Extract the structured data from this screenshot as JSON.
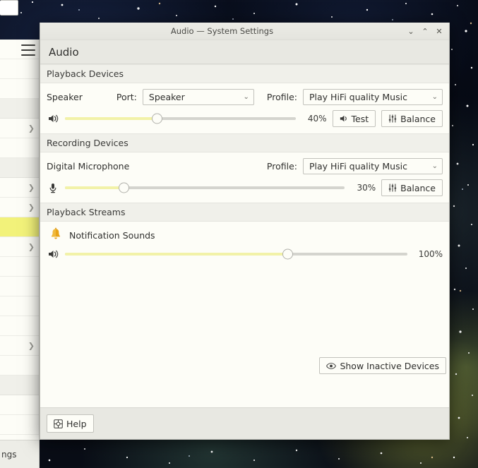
{
  "window": {
    "title": "Audio — System Settings",
    "controls": [
      {
        "name": "minimize",
        "glyph": "⌄"
      },
      {
        "name": "maximize",
        "glyph": "⌃"
      },
      {
        "name": "close",
        "glyph": "✕"
      }
    ]
  },
  "header": {
    "menu_icon": "hamburger-icon",
    "page_title": "Audio"
  },
  "sections": {
    "playback_devices": {
      "title": "Playback Devices",
      "device_name": "Speaker",
      "port_label": "Port:",
      "port_value": "Speaker",
      "profile_label": "Profile:",
      "profile_value": "Play HiFi quality Music",
      "volume_percent": "40%",
      "volume_value": 40,
      "test_label": "Test",
      "balance_label": "Balance"
    },
    "recording_devices": {
      "title": "Recording Devices",
      "device_name": "Digital Microphone",
      "profile_label": "Profile:",
      "profile_value": "Play HiFi quality Music",
      "volume_percent": "30%",
      "volume_value": 21,
      "balance_label": "Balance"
    },
    "playback_streams": {
      "title": "Playback Streams",
      "stream_name": "Notification Sounds",
      "volume_percent": "100%",
      "volume_value": 65
    }
  },
  "footer": {
    "show_inactive_label": "Show Inactive Devices",
    "help_label": "Help"
  },
  "background_list": {
    "bottom_label": "ngs",
    "rows": [
      {
        "type": "item",
        "chevron": false
      },
      {
        "type": "item",
        "chevron": false
      },
      {
        "type": "item",
        "chevron": false
      },
      {
        "type": "group",
        "chevron": false
      },
      {
        "type": "item",
        "chevron": true
      },
      {
        "type": "item",
        "chevron": false
      },
      {
        "type": "group",
        "chevron": false
      },
      {
        "type": "item",
        "chevron": true
      },
      {
        "type": "item",
        "chevron": true
      },
      {
        "type": "selected",
        "chevron": false
      },
      {
        "type": "item",
        "chevron": true
      },
      {
        "type": "item",
        "chevron": false
      },
      {
        "type": "item",
        "chevron": false
      },
      {
        "type": "item",
        "chevron": false
      },
      {
        "type": "item",
        "chevron": false
      },
      {
        "type": "item",
        "chevron": true
      },
      {
        "type": "item",
        "chevron": false
      },
      {
        "type": "group",
        "chevron": false
      },
      {
        "type": "item",
        "chevron": false
      },
      {
        "type": "item",
        "chevron": false
      }
    ]
  },
  "colors": {
    "slider_fill": "#f2f2a8",
    "selected_row": "#f2f27a",
    "bell_icon": "#e8a317",
    "panel_bg": "#fdfdf7",
    "chrome_bg": "#e8e8e2"
  }
}
